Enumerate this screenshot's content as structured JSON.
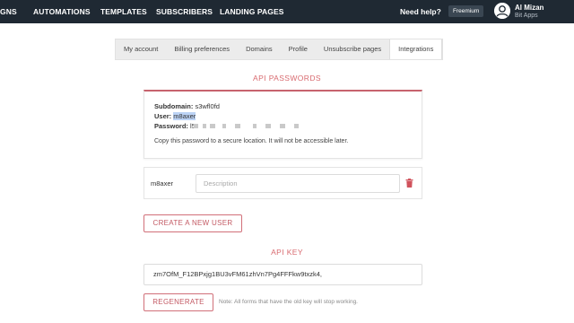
{
  "nav": {
    "items": [
      "GNS",
      "AUTOMATIONS",
      "TEMPLATES",
      "SUBSCRIBERS",
      "LANDING PAGES"
    ],
    "help": "Need help?",
    "plan": "Freemium",
    "user_name": "Al Mizan",
    "user_org": "Bit Apps"
  },
  "tabs": [
    {
      "label": "My account",
      "active": false
    },
    {
      "label": "Billing preferences",
      "active": false
    },
    {
      "label": "Domains",
      "active": false
    },
    {
      "label": "Profile",
      "active": false
    },
    {
      "label": "Unsubscribe pages",
      "active": false
    },
    {
      "label": "Integrations",
      "active": true
    }
  ],
  "api_passwords": {
    "title": "API PASSWORDS",
    "subdomain_label": "Subdomain:",
    "subdomain_value": "s3wfl0fd",
    "user_label": "User:",
    "user_value": "m8axer",
    "password_label": "Password:",
    "password_value": "l5",
    "note": "Copy this password to a secure location. It will not be accessible later."
  },
  "users": [
    {
      "name": "m8axer",
      "description_placeholder": "Description",
      "description": ""
    }
  ],
  "create_user_button": "CREATE A NEW USER",
  "api_key": {
    "title": "API KEY",
    "value": "zm7OfM_F12BPxjg1BU3vFM61zhVn7Pg4FFFkw9txzk4,",
    "regenerate_button": "REGENERATE",
    "note": "Note: All forms that have the old key will stop working."
  },
  "colors": {
    "accent": "#c7636d",
    "nav_bg": "#1f2933",
    "delete_icon": "#d0525c"
  }
}
